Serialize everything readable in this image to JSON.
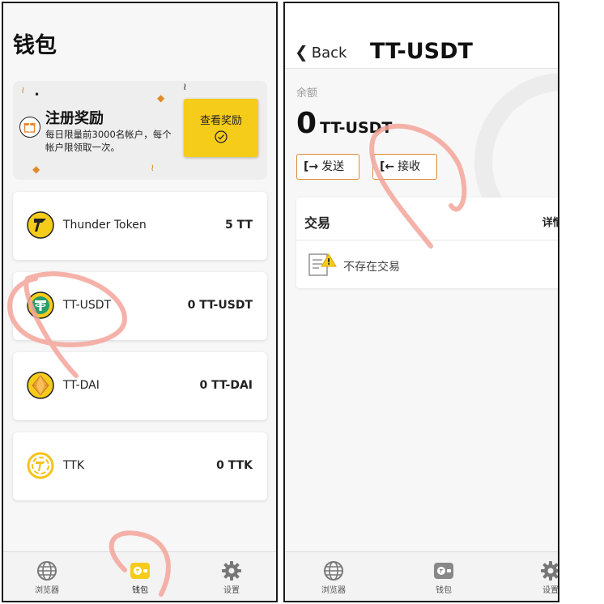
{
  "wallet_screen": {
    "title": "钱包",
    "banner": {
      "title": "注册奖励",
      "description": "每日限量前3000名帐户，每个帐户限领取一次。",
      "button_label": "查看奖励"
    },
    "tokens": [
      {
        "name": "Thunder Token",
        "balance": "5 TT",
        "icon": "thunder-token-icon"
      },
      {
        "name": "TT-USDT",
        "balance": "0 TT-USDT",
        "icon": "tt-usdt-icon"
      },
      {
        "name": "TT-DAI",
        "balance": "0 TT-DAI",
        "icon": "tt-dai-icon"
      },
      {
        "name": "TTK",
        "balance": "0 TTK",
        "icon": "ttk-icon"
      }
    ],
    "tabbar": [
      {
        "label": "浏览器",
        "icon": "globe-icon"
      },
      {
        "label": "钱包",
        "icon": "wallet-icon",
        "active": true
      },
      {
        "label": "设置",
        "icon": "gear-icon"
      }
    ]
  },
  "detail_screen": {
    "back_label": "Back",
    "title": "TT-USDT",
    "balance_label": "余额",
    "balance_value": "0",
    "balance_unit": "TT-USDT",
    "send_label": "发送",
    "receive_label": "接收",
    "transactions": {
      "title": "交易",
      "more_label": "详情 >>",
      "empty_label": "不存在交易"
    },
    "tabbar": [
      {
        "label": "浏览器",
        "icon": "globe-icon"
      },
      {
        "label": "钱包",
        "icon": "wallet-icon"
      },
      {
        "label": "设置",
        "icon": "gear-icon"
      }
    ]
  },
  "colors": {
    "accent_yellow": "#f6cc1b",
    "accent_orange": "#e08a3a",
    "annotation_pink": "#f3a59a"
  }
}
